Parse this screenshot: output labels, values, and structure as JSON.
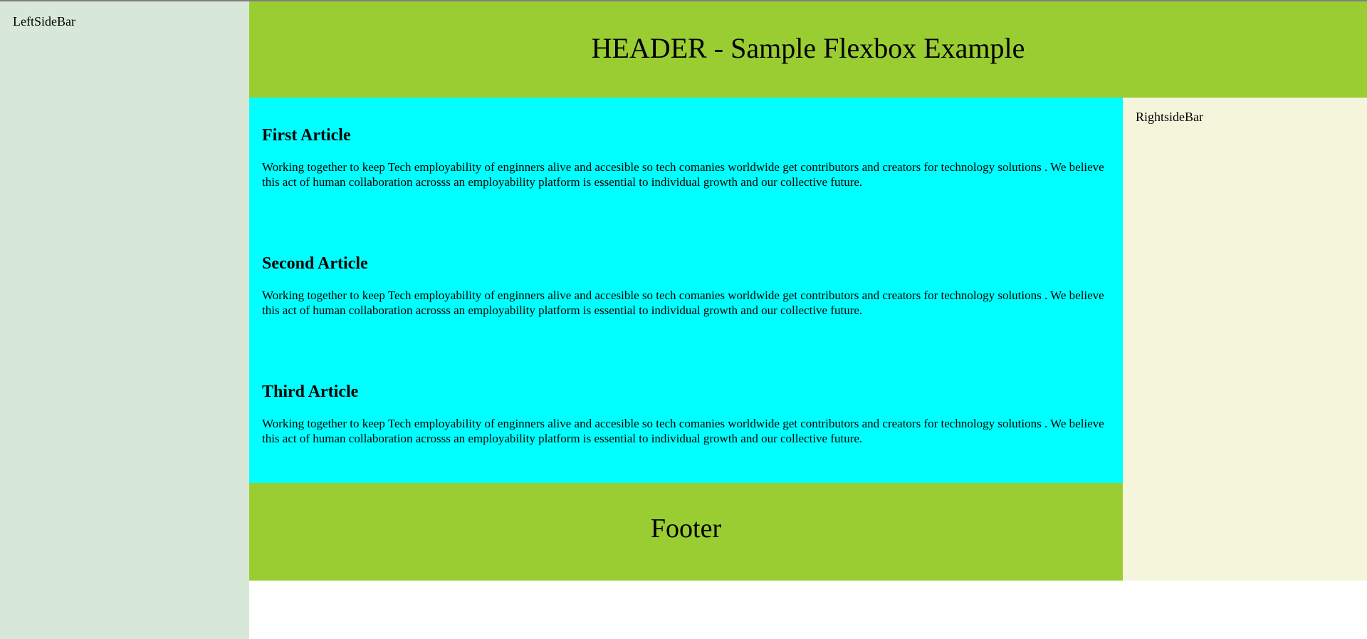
{
  "left_sidebar": {
    "label": "LeftSideBar"
  },
  "header": {
    "title": "HEADER - Sample Flexbox Example"
  },
  "main": {
    "articles": [
      {
        "title": "First Article",
        "body": "Working together to keep Tech employability of enginners alive and accesible so tech comanies worldwide get contributors and creators for technology solutions . We believe this act of human collaboration acrosss an employability platform is essential to individual growth and our collective future."
      },
      {
        "title": "Second Article",
        "body": "Working together to keep Tech employability of enginners alive and accesible so tech comanies worldwide get contributors and creators for technology solutions . We believe this act of human collaboration acrosss an employability platform is essential to individual growth and our collective future."
      },
      {
        "title": "Third Article",
        "body": "Working together to keep Tech employability of enginners alive and accesible so tech comanies worldwide get contributors and creators for technology solutions . We believe this act of human collaboration acrosss an employability platform is essential to individual growth and our collective future."
      }
    ]
  },
  "right_sidebar": {
    "label": "RightsideBar"
  },
  "footer": {
    "label": "Footer"
  },
  "colors": {
    "header_bg": "#9acd32",
    "footer_bg": "#9acd32",
    "main_bg": "#00ffff",
    "left_sidebar_bg": "#d8e8d8",
    "right_sidebar_bg": "#f5f5dc"
  }
}
